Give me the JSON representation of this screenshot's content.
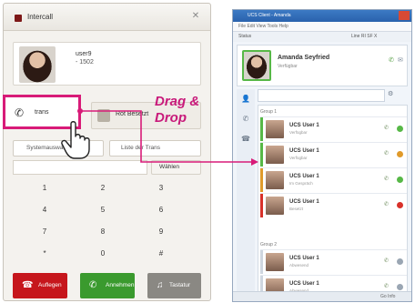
{
  "left_panel": {
    "title": "Intercall",
    "contact": {
      "name": "user9",
      "extension": "- 1502"
    },
    "transfer_label": "trans",
    "second_label": "Rot Besetzt",
    "tabs": [
      "Systemauswahl",
      "Liste der Trans"
    ],
    "dial_button": "Wählen",
    "keypad": [
      "1",
      "2",
      "3",
      "4",
      "5",
      "6",
      "7",
      "8",
      "9",
      "*",
      "0",
      "#"
    ],
    "call_buttons": {
      "hangup": "Auflegen",
      "answer": "Annehmen",
      "keypad": "Tastatur"
    }
  },
  "drag_text": {
    "line1": "Drag &",
    "line2": "Drop"
  },
  "right_window": {
    "title": "UCS Client - Amanda",
    "menu": "File   Edit   View   Tools   Help",
    "status_left": "Status",
    "status_right": "Line  RI  SF  X",
    "me": {
      "name": "Amanda Seyfried",
      "sub": "Verfügbar"
    },
    "groups": [
      "Group 1",
      "Group 2"
    ],
    "contacts": [
      {
        "name": "UCS User 1",
        "sub": "Verfügbar",
        "bar": "#57b847",
        "status": "#57b847"
      },
      {
        "name": "UCS User 1",
        "sub": "Verfügbar",
        "bar": "#57b847",
        "status": "#e09a2a"
      },
      {
        "name": "UCS User 1",
        "sub": "Im Gespräch",
        "bar": "#e09a2a",
        "status": "#57b847"
      },
      {
        "name": "UCS User 1",
        "sub": "Besetzt",
        "bar": "#d8312a",
        "status": "#d8312a"
      },
      {
        "name": "UCS User 1",
        "sub": "Abwesend",
        "bar": "#cfd6df",
        "status": "#9aa6b3"
      },
      {
        "name": "UCS User 1",
        "sub": "Abwesend",
        "bar": "#cfd6df",
        "status": "#9aa6b3"
      }
    ],
    "bottom": "Go  Info"
  },
  "colors": {
    "accent": "#d81b78",
    "hangup": "#c6161c",
    "answer": "#3a9a2e"
  }
}
